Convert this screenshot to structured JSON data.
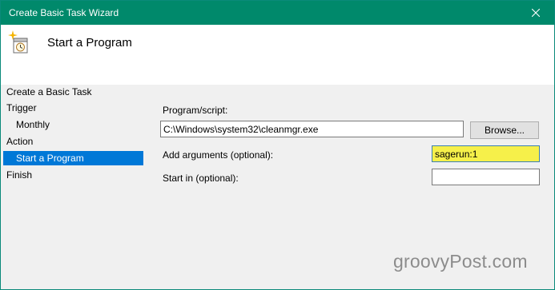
{
  "window": {
    "title": "Create Basic Task Wizard"
  },
  "header": {
    "title": "Start a Program",
    "icon": "task-scheduler-icon"
  },
  "sidebar": {
    "items": [
      {
        "label": "Create a Basic Task"
      },
      {
        "label": "Trigger"
      },
      {
        "label": "Monthly"
      },
      {
        "label": "Action"
      },
      {
        "label": "Start a Program",
        "selected": true
      },
      {
        "label": "Finish"
      }
    ]
  },
  "form": {
    "program_label": "Program/script:",
    "program_value": "C:\\Windows\\system32\\cleanmgr.exe",
    "browse_label": "Browse...",
    "arguments_label": "Add arguments (optional):",
    "arguments_value": "sagerun:1",
    "start_in_label": "Start in (optional):",
    "start_in_value": ""
  },
  "watermark": {
    "text": "groovyPost.com"
  },
  "colors": {
    "titlebar": "#00896b",
    "selection": "#0078d7",
    "highlight": "#f6f04a"
  }
}
